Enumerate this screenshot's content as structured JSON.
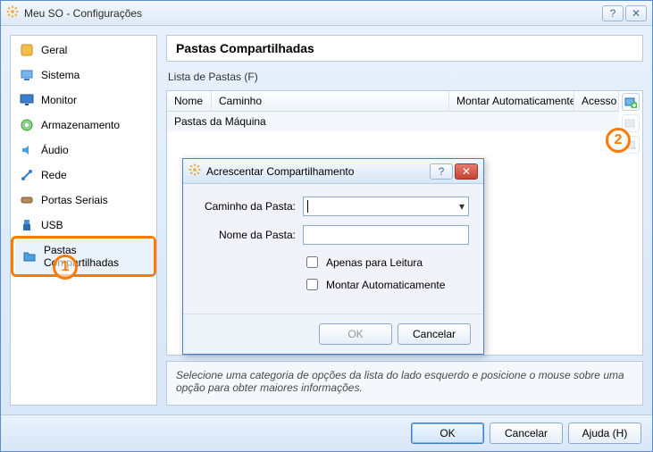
{
  "window": {
    "title": "Meu SO - Configurações"
  },
  "sidebar": {
    "items": [
      {
        "label": "Geral"
      },
      {
        "label": "Sistema"
      },
      {
        "label": "Monitor"
      },
      {
        "label": "Armazenamento"
      },
      {
        "label": "Áudio"
      },
      {
        "label": "Rede"
      },
      {
        "label": "Portas Seriais"
      },
      {
        "label": "USB"
      },
      {
        "label": "Pastas Compartilhadas"
      }
    ]
  },
  "main": {
    "title": "Pastas Compartilhadas",
    "list_label": "Lista de Pastas (F)",
    "columns": {
      "nome": "Nome",
      "caminho": "Caminho",
      "montar": "Montar Automaticamente",
      "acesso": "Acesso"
    },
    "group_row": "Pastas da Máquina",
    "info": "Selecione uma categoria de opções da lista do lado esquerdo e posicione o mouse sobre uma opção para obter maiores informações."
  },
  "dialog": {
    "title": "Acrescentar Compartilhamento",
    "path_label": "Caminho da Pasta:",
    "name_label": "Nome da Pasta:",
    "path_value": "",
    "name_value": "",
    "readonly_label": "Apenas para Leitura",
    "automount_label": "Montar Automaticamente",
    "ok": "OK",
    "cancel": "Cancelar"
  },
  "footer": {
    "ok": "OK",
    "cancel": "Cancelar",
    "help": "Ajuda (H)"
  },
  "annotations": {
    "one": "1",
    "two": "2"
  }
}
